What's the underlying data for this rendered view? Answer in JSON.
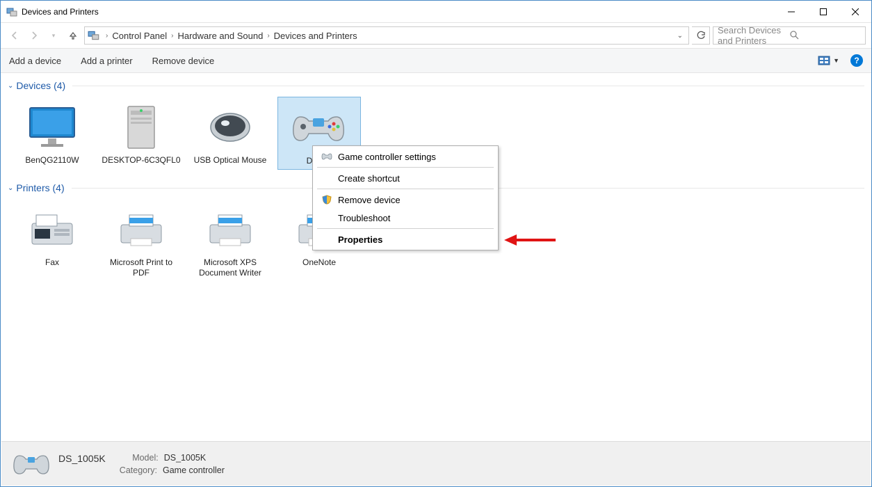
{
  "window": {
    "title": "Devices and Printers"
  },
  "breadcrumbs": {
    "items": [
      "Control Panel",
      "Hardware and Sound",
      "Devices and Printers"
    ]
  },
  "search": {
    "placeholder": "Search Devices and Printers"
  },
  "toolbar": {
    "add_device": "Add a device",
    "add_printer": "Add a printer",
    "remove_device": "Remove device"
  },
  "groups": {
    "devices": {
      "title": "Devices (4)",
      "items": [
        {
          "label": "BenQG2110W",
          "kind": "monitor"
        },
        {
          "label": "DESKTOP-6C3QFL0",
          "kind": "tower"
        },
        {
          "label": "USB Optical Mouse",
          "kind": "mouse"
        },
        {
          "label": "DS_10",
          "kind": "gamepad",
          "selected": true
        }
      ]
    },
    "printers": {
      "title": "Printers (4)",
      "items": [
        {
          "label": "Fax",
          "kind": "fax"
        },
        {
          "label": "Microsoft Print to PDF",
          "kind": "printer"
        },
        {
          "label": "Microsoft XPS Document Writer",
          "kind": "printer"
        },
        {
          "label": "OneNote",
          "kind": "printer"
        }
      ]
    }
  },
  "context_menu": {
    "items": [
      {
        "label": "Game controller settings",
        "icon": "gamepad"
      },
      {
        "label": "Create shortcut"
      },
      {
        "label": "Remove device",
        "icon": "shield"
      },
      {
        "label": "Troubleshoot"
      },
      {
        "label": "Properties",
        "bold": true
      }
    ]
  },
  "status": {
    "name": "DS_1005K",
    "model_key": "Model:",
    "model_val": "DS_1005K",
    "category_key": "Category:",
    "category_val": "Game controller"
  }
}
